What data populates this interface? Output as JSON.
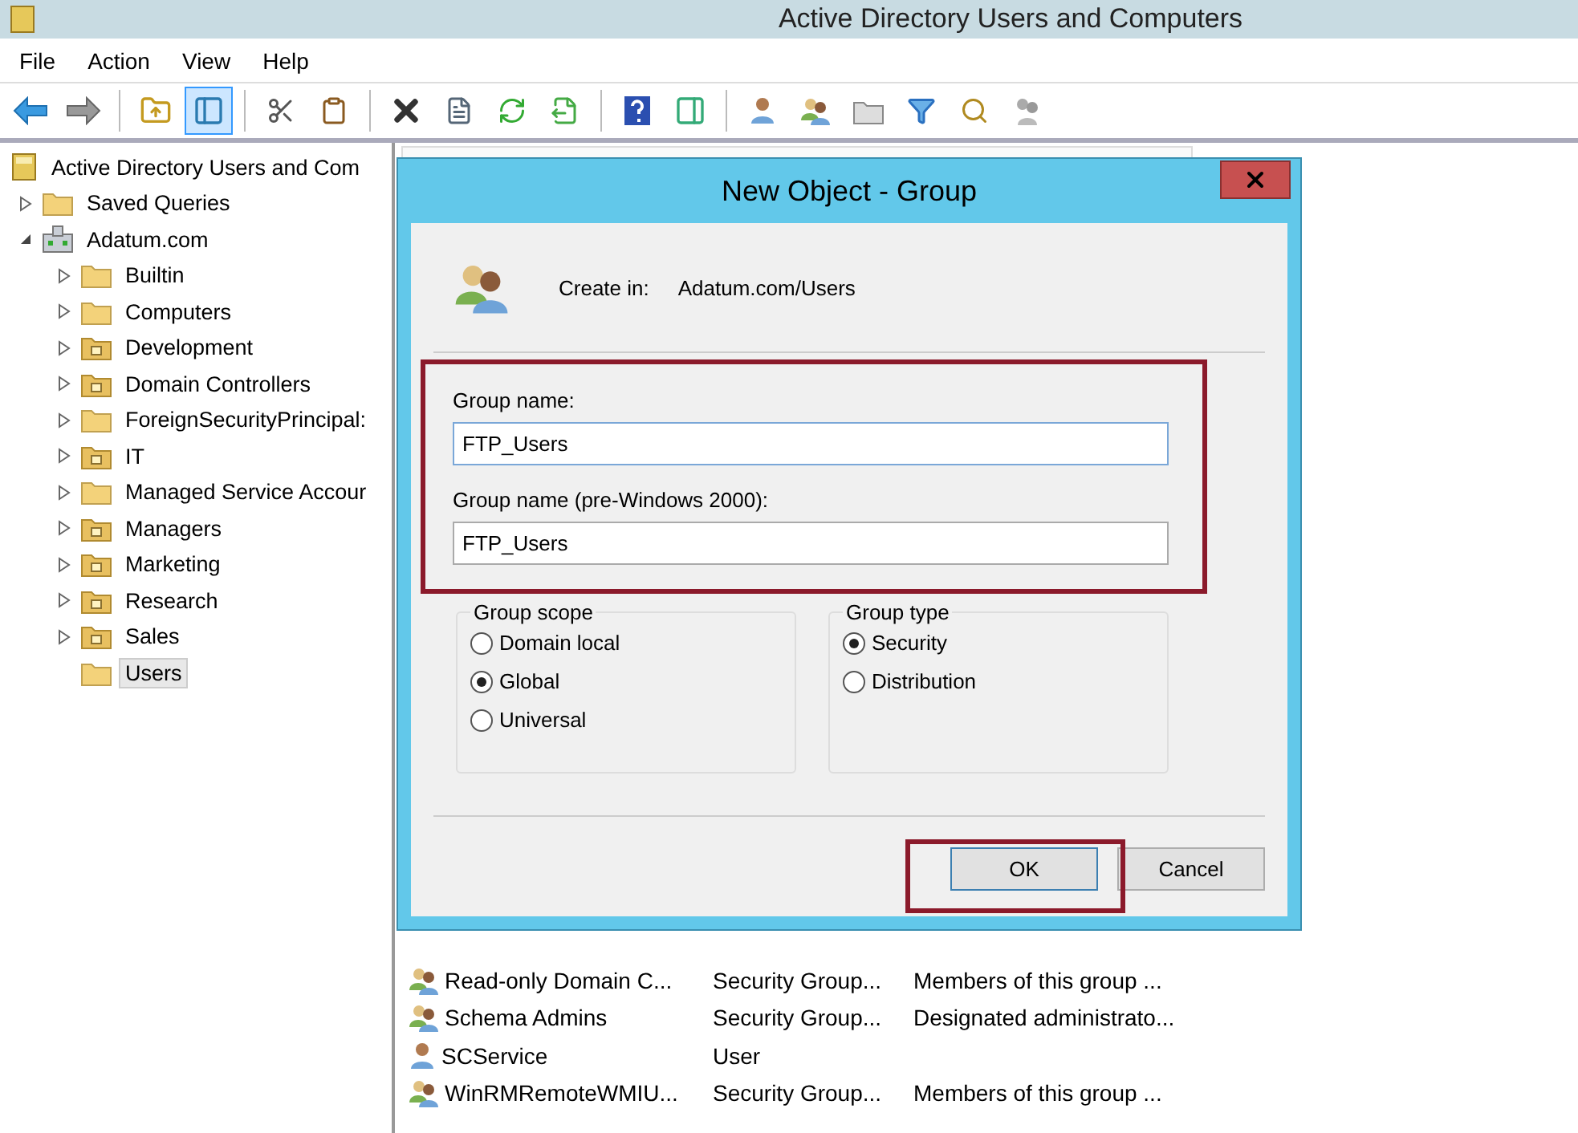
{
  "window": {
    "title": "Active Directory Users and Computers"
  },
  "menu": [
    "File",
    "Action",
    "View",
    "Help"
  ],
  "toolbar": [
    {
      "kind": "back",
      "selected": false
    },
    {
      "kind": "forward",
      "selected": false
    },
    {
      "kind": "sep"
    },
    {
      "kind": "up",
      "selected": false
    },
    {
      "kind": "tree",
      "selected": true
    },
    {
      "kind": "sep"
    },
    {
      "kind": "cut",
      "selected": false
    },
    {
      "kind": "paste",
      "selected": false
    },
    {
      "kind": "sep"
    },
    {
      "kind": "delete",
      "selected": false
    },
    {
      "kind": "properties",
      "selected": false
    },
    {
      "kind": "refresh",
      "selected": false
    },
    {
      "kind": "export",
      "selected": false
    },
    {
      "kind": "sep"
    },
    {
      "kind": "help",
      "selected": false
    },
    {
      "kind": "action",
      "selected": false
    },
    {
      "kind": "sep"
    },
    {
      "kind": "newuser",
      "selected": false
    },
    {
      "kind": "newgroup",
      "selected": false
    },
    {
      "kind": "newou",
      "selected": false
    },
    {
      "kind": "filter",
      "selected": false
    },
    {
      "kind": "find",
      "selected": false
    },
    {
      "kind": "addgroup",
      "selected": false
    }
  ],
  "tree": {
    "label": "Active Directory Users and Com",
    "kind": "root",
    "selected": false,
    "children": [
      {
        "label": "Saved Queries",
        "kind": "folder",
        "expanded": false,
        "selected": false
      },
      {
        "label": "Adatum.com",
        "kind": "domain",
        "expanded": true,
        "selected": false,
        "children": [
          {
            "label": "Builtin",
            "kind": "folder",
            "expanded": false,
            "selected": false
          },
          {
            "label": "Computers",
            "kind": "folder",
            "expanded": false,
            "selected": false
          },
          {
            "label": "Development",
            "kind": "ou",
            "expanded": false,
            "selected": false
          },
          {
            "label": "Domain Controllers",
            "kind": "ou",
            "expanded": false,
            "selected": false
          },
          {
            "label": "ForeignSecurityPrincipal:",
            "kind": "folder",
            "expanded": false,
            "selected": false
          },
          {
            "label": "IT",
            "kind": "ou",
            "expanded": false,
            "selected": false
          },
          {
            "label": "Managed Service Accour",
            "kind": "folder",
            "expanded": false,
            "selected": false
          },
          {
            "label": "Managers",
            "kind": "ou",
            "expanded": false,
            "selected": false
          },
          {
            "label": "Marketing",
            "kind": "ou",
            "expanded": false,
            "selected": false
          },
          {
            "label": "Research",
            "kind": "ou",
            "expanded": false,
            "selected": false
          },
          {
            "label": "Sales",
            "kind": "ou",
            "expanded": false,
            "selected": false
          },
          {
            "label": "Users",
            "kind": "folder",
            "selected": true
          }
        ]
      }
    ]
  },
  "list": {
    "rows": [
      {
        "kind": "group",
        "name": "Read-only Domain C...",
        "type": "Security Group...",
        "description": "Members of this group ..."
      },
      {
        "kind": "group",
        "name": "Schema Admins",
        "type": "Security Group...",
        "description": "Designated administrato..."
      },
      {
        "kind": "user",
        "name": "SCService",
        "type": "User",
        "description": ""
      },
      {
        "kind": "group",
        "name": "WinRMRemoteWMIU...",
        "type": "Security Group...",
        "description": "Members of this group ..."
      }
    ]
  },
  "dialog": {
    "title": "New Object - Group",
    "create_in_label": "Create in:",
    "create_in_value": "Adatum.com/Users",
    "fields": [
      {
        "label": "Group name:",
        "value": "FTP_Users",
        "focused": true
      },
      {
        "label": "Group name (pre-Windows 2000):",
        "value": "FTP_Users",
        "focused": false
      }
    ],
    "groups": [
      {
        "title": "Group scope",
        "options": [
          {
            "label": "Domain local",
            "selected": false
          },
          {
            "label": "Global",
            "selected": true
          },
          {
            "label": "Universal",
            "selected": false
          }
        ]
      },
      {
        "title": "Group type",
        "options": [
          {
            "label": "Security",
            "selected": true
          },
          {
            "label": "Distribution",
            "selected": false
          }
        ]
      }
    ],
    "buttons": [
      {
        "label": "OK",
        "default": true
      },
      {
        "label": "Cancel",
        "default": false
      }
    ]
  }
}
